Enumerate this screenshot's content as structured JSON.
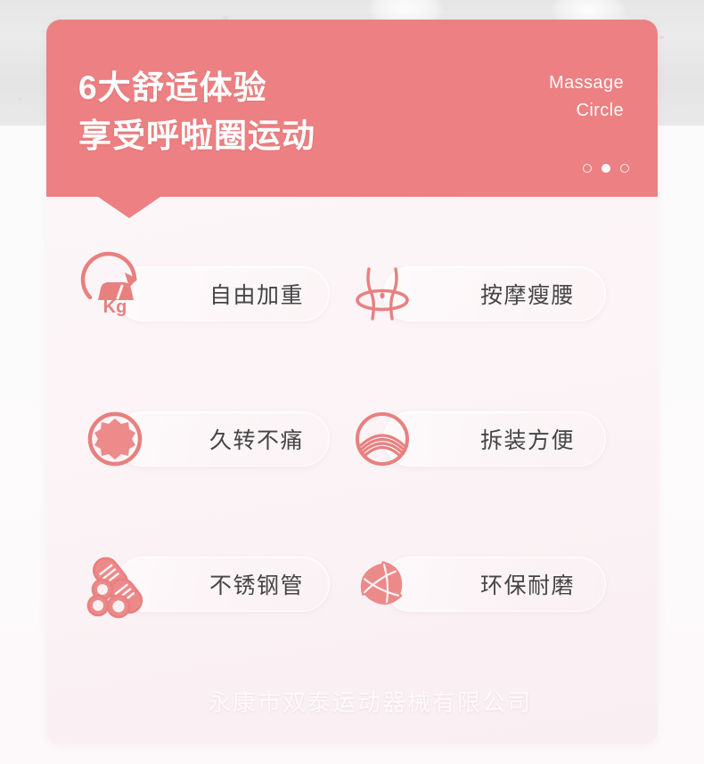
{
  "card": {
    "header": {
      "headline": "6大舒适体验\n享受呼啦圈运动",
      "brand_en": "Massage\nCircle",
      "dots": [
        {
          "name": "dot-1",
          "active": false
        },
        {
          "name": "dot-2",
          "active": true
        },
        {
          "name": "dot-3",
          "active": false
        }
      ],
      "bg_color": "#ec8082",
      "text_color": "#ffffff"
    },
    "features": [
      {
        "icon": "weight-kg-icon",
        "icon_text": "Kg",
        "label": "自由加重",
        "column": "left",
        "row": 1
      },
      {
        "icon": "waist-hoop-icon",
        "icon_text": "",
        "label": "按摩瘦腰",
        "column": "right",
        "row": 1
      },
      {
        "icon": "massage-nub-wheel-icon",
        "icon_text": "",
        "label": "久转不痛",
        "column": "left",
        "row": 2
      },
      {
        "icon": "stacked-arcs-icon",
        "icon_text": "",
        "label": "拆装方便",
        "column": "right",
        "row": 2
      },
      {
        "icon": "steel-tubes-icon",
        "icon_text": "",
        "label": "不锈钢管",
        "column": "left",
        "row": 3
      },
      {
        "icon": "three-leaves-eco-icon",
        "icon_text": "",
        "label": "环保耐磨",
        "column": "right",
        "row": 3
      }
    ],
    "watermark": "永康市双泰运动器械有限公司",
    "body_bg_color": "#fbf3f6",
    "label_color": "#454545",
    "accent_color": "#e8807f"
  }
}
